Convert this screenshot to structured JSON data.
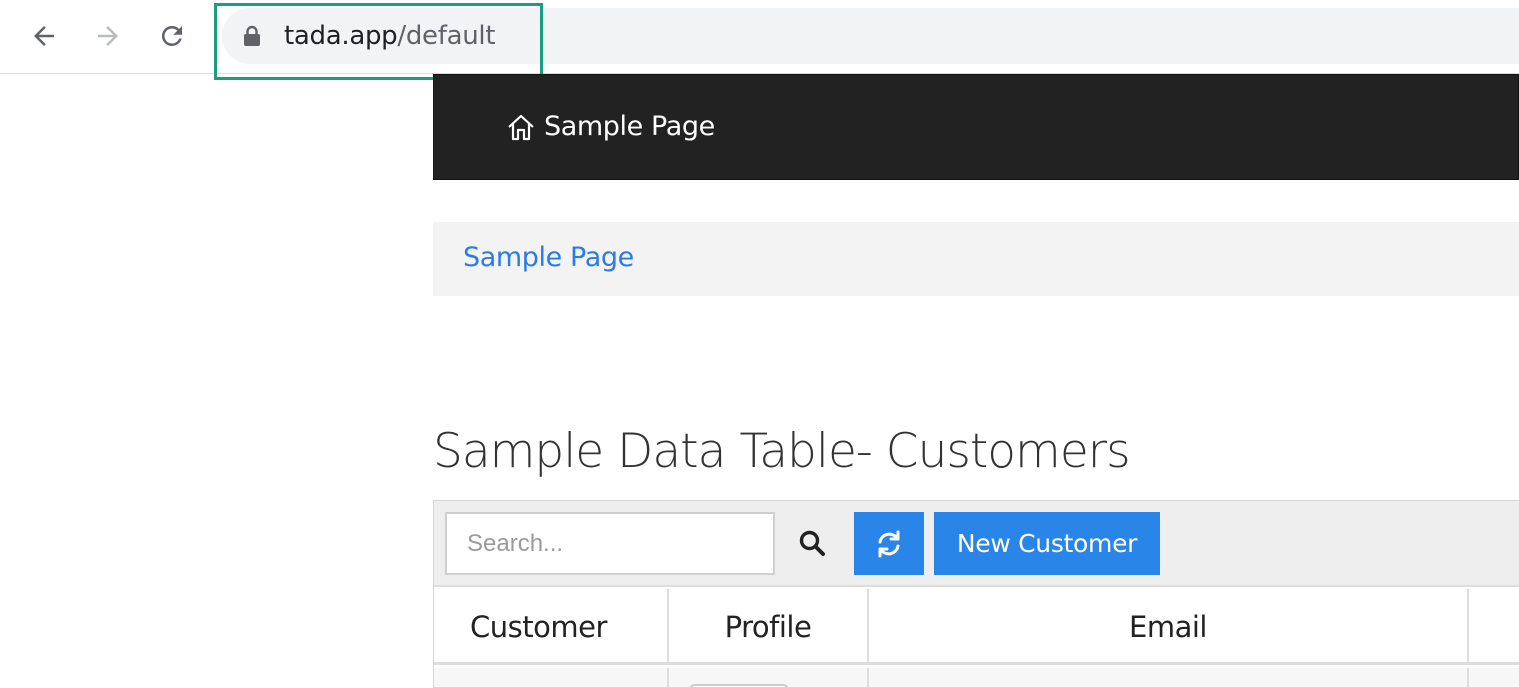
{
  "browser": {
    "url_host": "tada.app",
    "url_path": "/default",
    "icons": {
      "back": "arrow-left-icon",
      "forward": "arrow-right-icon",
      "reload": "reload-icon",
      "lock": "lock-icon"
    }
  },
  "header": {
    "brand_label": "Sample Page",
    "brand_icon": "home-icon"
  },
  "breadcrumb": {
    "items": [
      {
        "label": "Sample Page"
      }
    ]
  },
  "main": {
    "title": "Sample Data Table- Customers"
  },
  "table": {
    "search": {
      "placeholder": "Search...",
      "value": ""
    },
    "refresh_icon": "refresh-icon",
    "search_icon": "search-icon",
    "new_button_label": "New Customer",
    "columns": [
      "Customer",
      "Profile",
      "Email"
    ]
  },
  "colors": {
    "header_bg": "#222222",
    "accent": "#2a85e8",
    "link": "#2c7be5",
    "highlight_border": "#1a9e7d"
  }
}
